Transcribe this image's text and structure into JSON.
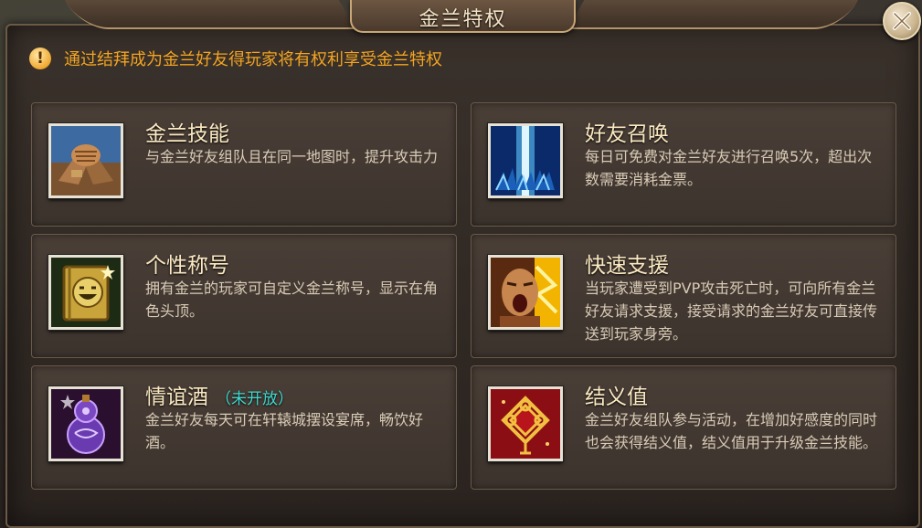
{
  "window": {
    "title": "金兰特权"
  },
  "notice": {
    "text": "通过结拜成为金兰好友得玩家将有权利享受金兰特权"
  },
  "cards": [
    {
      "title": "金兰技能",
      "badge": "",
      "desc": "与金兰好友组队且在同一地图时，提升攻击力",
      "icon": "handshake-icon"
    },
    {
      "title": "好友召唤",
      "badge": "",
      "desc": "每日可免费对金兰好友进行召唤5次，超出次数需要消耗金票。",
      "icon": "summon-beam-icon"
    },
    {
      "title": "个性称号",
      "badge": "",
      "desc": "拥有金兰的玩家可自定义金兰称号，显示在角色头顶。",
      "icon": "title-book-icon"
    },
    {
      "title": "快速支援",
      "badge": "",
      "desc": "当玩家遭受到PVP攻击死亡时，可向所有金兰好友请求支援，接受请求的金兰好友可直接传送到玩家身旁。",
      "icon": "shouting-warrior-icon"
    },
    {
      "title": "情谊酒",
      "badge": "（未开放）",
      "desc": "金兰好友每天可在轩辕城摆设宴席，畅饮好酒。",
      "icon": "gourd-wine-icon"
    },
    {
      "title": "结义值",
      "badge": "",
      "desc": "金兰好友组队参与活动，在增加好感度的同时也会获得结义值，结义值用于升级金兰技能。",
      "icon": "chinese-knot-icon"
    }
  ],
  "colors": {
    "notice": "#f2a422",
    "badge": "#3fd9d0",
    "title": "#fbe9c2"
  }
}
